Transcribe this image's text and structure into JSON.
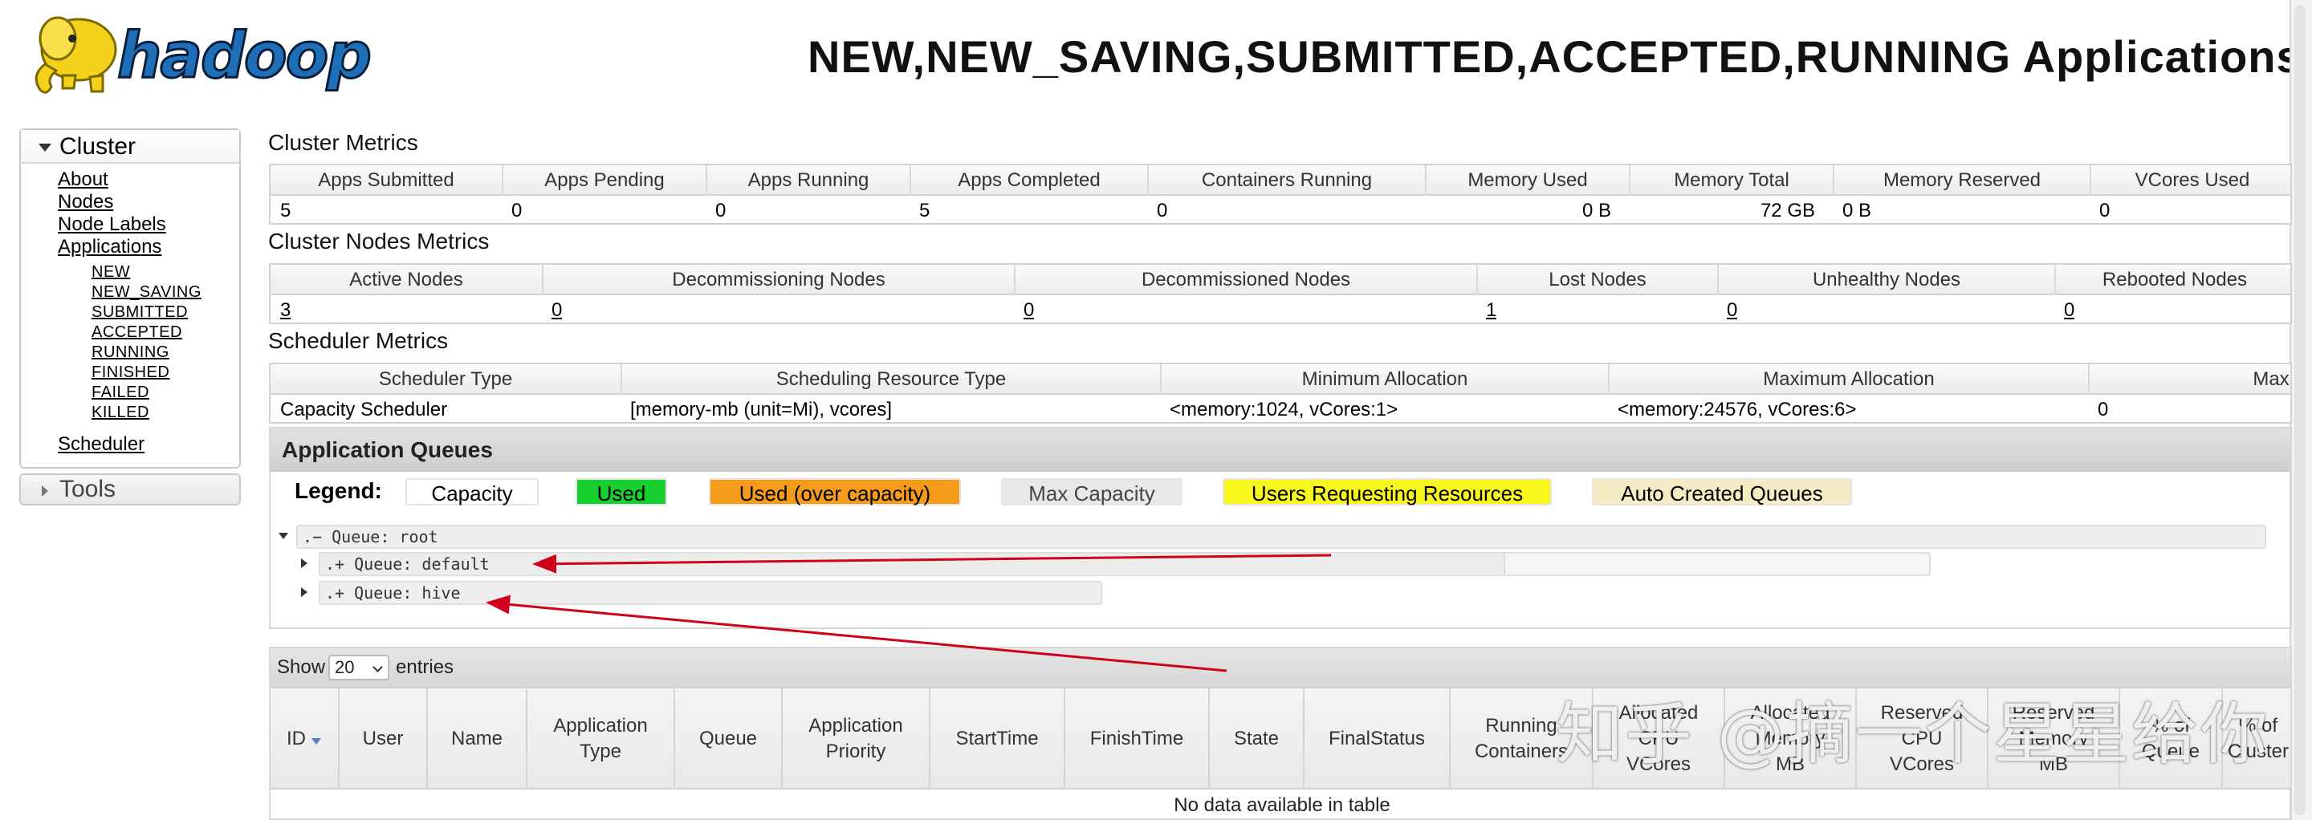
{
  "header": {
    "logo_text": "hadoop",
    "title": "NEW,NEW_SAVING,SUBMITTED,ACCEPTED,RUNNING Applications"
  },
  "sidebar": {
    "cluster_label": "Cluster",
    "links": [
      "About",
      "Nodes",
      "Node Labels",
      "Applications"
    ],
    "app_states": [
      "NEW",
      "NEW_SAVING",
      "SUBMITTED",
      "ACCEPTED",
      "RUNNING",
      "FINISHED",
      "FAILED",
      "KILLED"
    ],
    "scheduler_link": "Scheduler",
    "tools_label": "Tools"
  },
  "cluster_metrics": {
    "title": "Cluster Metrics",
    "headers": [
      "Apps Submitted",
      "Apps Pending",
      "Apps Running",
      "Apps Completed",
      "Containers Running",
      "Memory Used",
      "Memory Total",
      "Memory Reserved",
      "VCores Used"
    ],
    "values": [
      "5",
      "0",
      "0",
      "5",
      "0",
      "0 B",
      "72 GB",
      "0 B",
      "0"
    ]
  },
  "nodes_metrics": {
    "title": "Cluster Nodes Metrics",
    "headers": [
      "Active Nodes",
      "Decommissioning Nodes",
      "Decommissioned Nodes",
      "Lost Nodes",
      "Unhealthy Nodes",
      "Rebooted Nodes"
    ],
    "values": [
      "3",
      "0",
      "0",
      "1",
      "0",
      "0"
    ]
  },
  "scheduler_metrics": {
    "title": "Scheduler Metrics",
    "headers": [
      "Scheduler Type",
      "Scheduling Resource Type",
      "Minimum Allocation",
      "Maximum Allocation",
      "Maxi"
    ],
    "values": [
      "Capacity Scheduler",
      "[memory-mb (unit=Mi), vcores]",
      "<memory:1024, vCores:1>",
      "<memory:24576, vCores:6>",
      "0"
    ]
  },
  "queues": {
    "title": "Application Queues",
    "legend_label": "Legend:",
    "legend": [
      {
        "label": "Capacity",
        "color": "#ffffff",
        "text_color": "#000000"
      },
      {
        "label": "Used",
        "color": "#17cf2f",
        "text_color": "#000000"
      },
      {
        "label": "Used (over capacity)",
        "color": "#f59b1c",
        "text_color": "#000000"
      },
      {
        "label": "Max Capacity",
        "color": "#e8e8e8",
        "text_color": "#444444"
      },
      {
        "label": "Users Requesting Resources",
        "color": "#f7f71d",
        "text_color": "#000000"
      },
      {
        "label": "Auto Created Queues",
        "color": "#f6ecc3",
        "text_color": "#000000"
      }
    ],
    "tree": [
      {
        "label": ".− Queue: root"
      },
      {
        "label": ".+ Queue: default"
      },
      {
        "label": ".+ Queue: hive"
      }
    ]
  },
  "apps_table": {
    "show_label": "Show",
    "entries_value": "20",
    "entries_label": "entries",
    "columns": [
      "ID",
      "User",
      "Name",
      "Application\nType",
      "Queue",
      "Application\nPriority",
      "StartTime",
      "FinishTime",
      "State",
      "FinalStatus",
      "Running\nContainers",
      "Allocated\nCPU\nVCores",
      "Allocated\nMemory\nMB",
      "Reserved\nCPU\nVCores",
      "Reserved\nMemory\nMB",
      "% of\nQueue",
      "% of\nCluster"
    ],
    "empty_message": "No data available in table"
  },
  "watermark": "知乎 @摘一个星星给你",
  "colors": {
    "annotation_arrow": "#d0021b",
    "logo_yellow": "#f4d21b",
    "logo_blue": "#1e6fb8"
  }
}
